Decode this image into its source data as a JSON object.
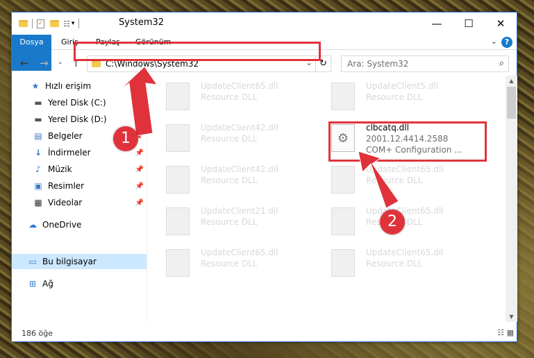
{
  "window": {
    "title": "System32",
    "controls": {
      "minimize": "—",
      "maximize": "☐",
      "close": "✕"
    }
  },
  "ribbon": {
    "tabs": [
      "Dosya",
      "Giriş",
      "Paylaş",
      "Görünüm"
    ],
    "help": "?"
  },
  "address": {
    "path": "C:\\Windows\\System32",
    "search_placeholder": "Ara: System32"
  },
  "nav": {
    "items": [
      {
        "label": "Hızlı erişim",
        "icon": "star-icon",
        "pinned": false
      },
      {
        "label": "Yerel Disk (C:)",
        "icon": "drive-icon",
        "pinned": true
      },
      {
        "label": "Yerel Disk (D:)",
        "icon": "drive-icon",
        "pinned": true
      },
      {
        "label": "Belgeler",
        "icon": "documents-icon",
        "pinned": true
      },
      {
        "label": "İndirmeler",
        "icon": "download-icon",
        "pinned": true
      },
      {
        "label": "Müzik",
        "icon": "music-icon",
        "pinned": true
      },
      {
        "label": "Resimler",
        "icon": "pictures-icon",
        "pinned": true
      },
      {
        "label": "Videolar",
        "icon": "videos-icon",
        "pinned": true
      },
      {
        "label": "OneDrive",
        "icon": "cloud-icon",
        "pinned": false
      },
      {
        "label": "Bu bilgisayar",
        "icon": "computer-icon",
        "pinned": false,
        "selected": true
      },
      {
        "label": "Ağ",
        "icon": "network-icon",
        "pinned": false
      }
    ]
  },
  "files": {
    "left": [
      {
        "name": "UpdateClient65.dll",
        "desc": "Resource DLL"
      },
      {
        "name": "UpdateClient42.dll",
        "desc": "Resource DLL"
      },
      {
        "name": "UpdateClient42.dll",
        "desc": "Resource DLL"
      },
      {
        "name": "UpdateClient21.dll",
        "desc": "Resource DLL"
      },
      {
        "name": "UpdateClient65.dll",
        "desc": "Resource DLL"
      }
    ],
    "right": [
      {
        "name": "UpdateClient5.dll",
        "desc": "Resource DLL"
      },
      {
        "name": "UpdateClient65.dll",
        "desc": "Resource DLL"
      },
      {
        "name": "UpdateClient65.dll",
        "desc": "Resource DLL"
      },
      {
        "name": "UpdateClient65.dll",
        "desc": "Resource DLL"
      }
    ],
    "main": {
      "name": "clbcatq.dll",
      "version": "2001.12.4414.2588",
      "desc": "COM+ Configuration ..."
    }
  },
  "status": {
    "count": "186 öğe"
  },
  "annotations": {
    "badge1": "1",
    "badge2": "2",
    "color": "#e0323b"
  }
}
